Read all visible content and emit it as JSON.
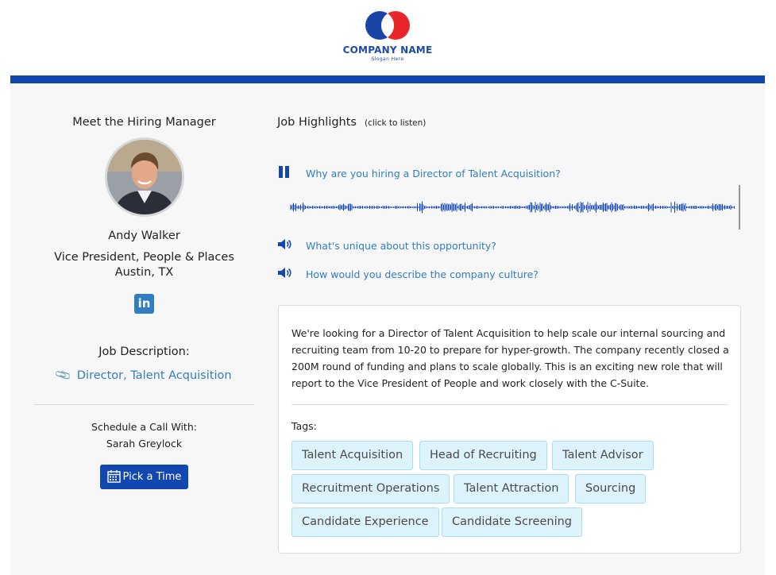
{
  "header": {
    "company_name": "COMPANY NAME",
    "slogan": "Slogan Here",
    "logo_colors": {
      "left": "#1b44a8",
      "right": "#e8262b"
    }
  },
  "colors": {
    "brand_blue": "#1347b0",
    "link_blue": "#2f7ec2",
    "tag_bg": "#dcf3fb",
    "tag_border": "#a8dff0"
  },
  "hiring_manager": {
    "section_title": "Meet the Hiring Manager",
    "name": "Andy Walker",
    "role": "Vice President, People & Places",
    "location": "Austin, TX",
    "linkedin_icon": "linkedin-icon",
    "linkedin_glyph": "in"
  },
  "job_description": {
    "label": "Job Description:",
    "link_text": "Director, Talent Acquisition",
    "clip_icon": "paperclip-icon"
  },
  "schedule": {
    "label": "Schedule a Call With:",
    "name": "Sarah Greylock",
    "button_label": "Pick a Time",
    "button_icon": "calendar-icon"
  },
  "highlights": {
    "title": "Job Highlights",
    "hint": "(click to listen)",
    "questions": [
      {
        "text": "Why are you hiring a Director of Talent Acquisition?",
        "icon": "pause-icon",
        "playing": true
      },
      {
        "text": "What's unique about this opportunity?",
        "icon": "speaker-icon",
        "playing": false
      },
      {
        "text": "How would you describe the company culture?",
        "icon": "speaker-icon",
        "playing": false
      }
    ]
  },
  "description": {
    "text": "We're looking for a Director of Talent Acquisition to help scale our internal sourcing and recruiting team from 10-20 to prepare for hyper-growth. The company recently closed a 200M round of funding and plans to scale globally. This is an exciting new role that will report to the Vice President of People and work closely with the C-Suite.",
    "tags_label": "Tags:",
    "tags": [
      "Talent Acquisition",
      "Head of Recruiting",
      "Talent Advisor",
      "Recruitment Operations",
      "Talent Attraction",
      "Sourcing",
      "Candidate Experience",
      "Candidate Screening"
    ]
  }
}
